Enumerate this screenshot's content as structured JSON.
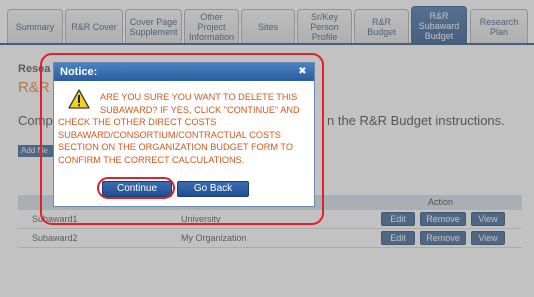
{
  "tabs": [
    {
      "label": "Summary",
      "active": false
    },
    {
      "label": "R&R Cover",
      "active": false
    },
    {
      "label": "Cover Page\nSupplement",
      "active": false
    },
    {
      "label": "Other\nProject\nInformation",
      "active": false
    },
    {
      "label": "Sites",
      "active": false
    },
    {
      "label": "Sr/Key\nPerson\nProfile",
      "active": false
    },
    {
      "label": "R&R Budget",
      "active": false
    },
    {
      "label": "R&R\nSubaward\nBudget",
      "active": true
    },
    {
      "label": "Research\nPlan",
      "active": false
    }
  ],
  "page": {
    "section_title": "Resea",
    "section_subtitle": "R&R",
    "instruction_start": "Comp",
    "instruction_end": "n the R&R Budget instructions.",
    "add_button": "Add Ne"
  },
  "table": {
    "action_header": "Action",
    "rows": [
      {
        "name": "Subaward1",
        "organization": "University",
        "edit": "Edit",
        "remove": "Remove",
        "view": "View"
      },
      {
        "name": "Subaward2",
        "organization": "My Organization",
        "edit": "Edit",
        "remove": "Remove",
        "view": "View"
      }
    ]
  },
  "dialog": {
    "title": "Notice:",
    "close_icon": "close-icon",
    "warning_icon": "warning-icon",
    "message_lines": [
      "ARE YOU SURE YOU WANT TO DELETE THIS",
      "SUBAWARD? IF YES, CLICK \"CONTINUE\" AND",
      "CHECK THE OTHER DIRECT COSTS",
      "SUBAWARD/CONSORTIUM/CONTRACTUAL COSTS",
      "SECTION ON THE ORGANIZATION BUDGET FORM TO",
      "CONFIRM THE CORRECT CALCULATIONS."
    ],
    "continue_label": "Continue",
    "goback_label": "Go Back"
  },
  "colors": {
    "accent": "#2d5a8f",
    "warning_text": "#d9571e",
    "annotation_red": "#e0202a"
  }
}
